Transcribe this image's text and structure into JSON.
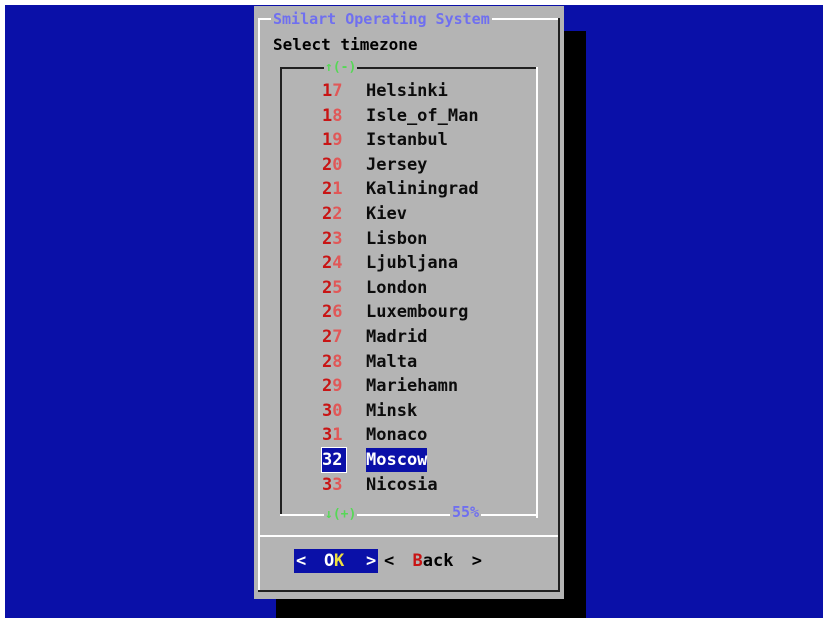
{
  "dialog": {
    "title": "Smilart Operating System",
    "prompt": "Select timezone",
    "scroll_up": "↑(-)",
    "scroll_down": "↓(+)",
    "scroll_percent": "55%"
  },
  "timezones": [
    {
      "num": "17",
      "name": "Helsinki"
    },
    {
      "num": "18",
      "name": "Isle_of_Man"
    },
    {
      "num": "19",
      "name": "Istanbul"
    },
    {
      "num": "20",
      "name": "Jersey"
    },
    {
      "num": "21",
      "name": "Kaliningrad"
    },
    {
      "num": "22",
      "name": "Kiev"
    },
    {
      "num": "23",
      "name": "Lisbon"
    },
    {
      "num": "24",
      "name": "Ljubljana"
    },
    {
      "num": "25",
      "name": "London"
    },
    {
      "num": "26",
      "name": "Luxembourg"
    },
    {
      "num": "27",
      "name": "Madrid"
    },
    {
      "num": "28",
      "name": "Malta"
    },
    {
      "num": "29",
      "name": "Mariehamn"
    },
    {
      "num": "30",
      "name": "Minsk"
    },
    {
      "num": "31",
      "name": "Monaco"
    },
    {
      "num": "32",
      "name": "Moscow"
    },
    {
      "num": "33",
      "name": "Nicosia"
    }
  ],
  "selected_num": "32",
  "buttons": {
    "ok": {
      "left": "<",
      "hot": "O",
      "rest": "K",
      "right": ">"
    },
    "back": {
      "left": "<",
      "hot": "B",
      "rest": "ack",
      "right": ">"
    }
  },
  "colors": {
    "screen": "#0a10a8",
    "dialog": "#b4b4b4",
    "title": "#6f6ff0",
    "number": "#c81414",
    "scroll_arrow": "#56d856",
    "selection": "#0a10a8"
  }
}
